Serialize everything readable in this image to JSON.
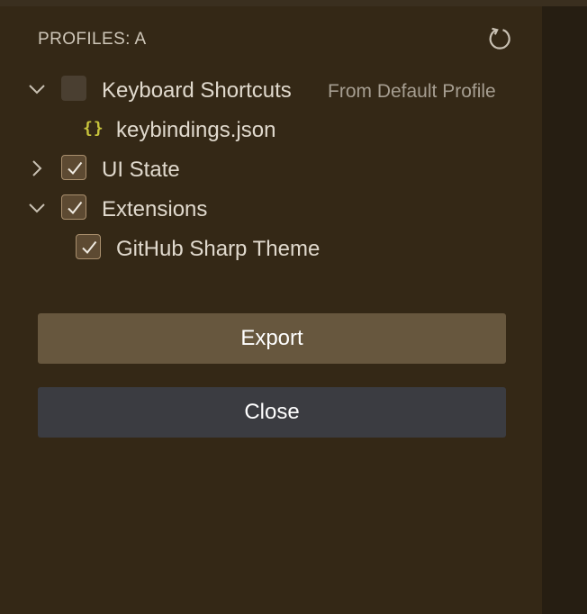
{
  "header": {
    "title": "PROFILES: A"
  },
  "tree": {
    "keyboard_shortcuts": {
      "label": "Keyboard Shortcuts",
      "description": "From Default Profile",
      "checked": false,
      "expanded": true,
      "children": [
        {
          "label": "keybindings.json",
          "icon": "json-braces-icon"
        }
      ]
    },
    "ui_state": {
      "label": "UI State",
      "checked": true,
      "expanded": false
    },
    "extensions": {
      "label": "Extensions",
      "checked": true,
      "expanded": true,
      "children": [
        {
          "label": "GitHub Sharp Theme",
          "checked": true
        }
      ]
    }
  },
  "actions": {
    "export_label": "Export",
    "close_label": "Close"
  },
  "colors": {
    "panel_background": "#342816",
    "primary_button": "#67573e",
    "secondary_button": "#3b3c41",
    "json_icon": "#c8c43c"
  }
}
